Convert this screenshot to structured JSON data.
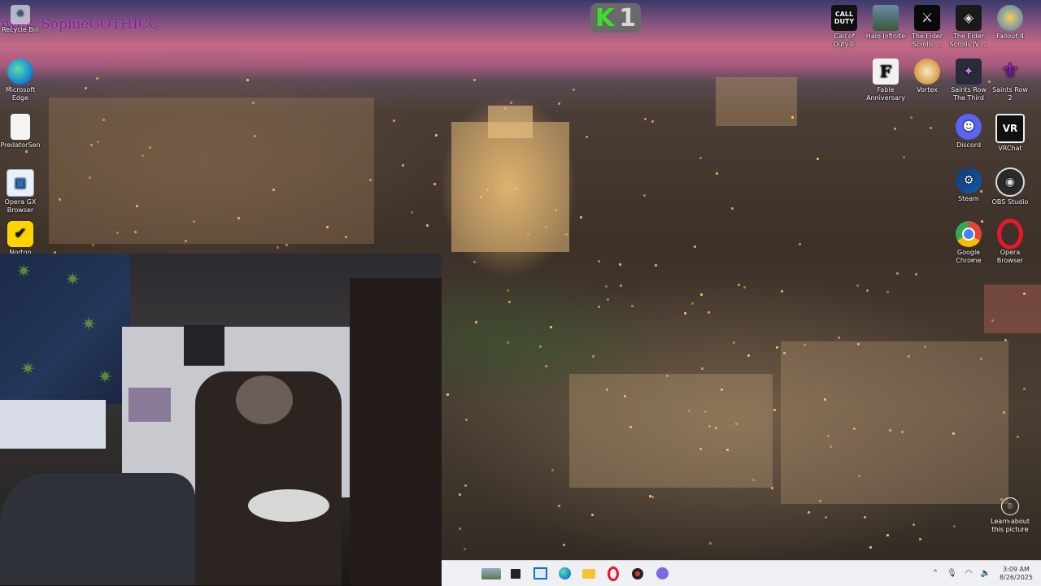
{
  "overlay": {
    "streamer_text": "ower: SophieGOTHICC",
    "badge": {
      "letter": "K",
      "number": "1"
    }
  },
  "desktop_icons_left": [
    {
      "name": "recycle-bin",
      "label": "Recycle Bin",
      "icon": "recycle-bin-icon"
    },
    {
      "name": "microsoft-edge",
      "label": "Microsoft Edge",
      "icon": "edge-icon"
    },
    {
      "name": "predatorsen",
      "label": "PredatorSen",
      "icon": "document-icon"
    },
    {
      "name": "opera-gx",
      "label": "Opera GX Browser",
      "icon": "opera-gx-icon"
    },
    {
      "name": "norton",
      "label": "Norton",
      "icon": "norton-icon"
    }
  ],
  "desktop_icons_right": [
    {
      "name": "call-of-duty",
      "label": "Call of Duty®",
      "icon": "call-of-duty-icon"
    },
    {
      "name": "halo-infinite",
      "label": "Halo Infinite",
      "icon": "halo-icon"
    },
    {
      "name": "elder-scrolls-1",
      "label": "The Elder Scrolls ...",
      "icon": "elder-scrolls-icon"
    },
    {
      "name": "elder-scrolls-iv",
      "label": "The Elder Scrolls IV ...",
      "icon": "oblivion-icon"
    },
    {
      "name": "fallout-4",
      "label": "Fallout 4",
      "icon": "fallout-icon"
    },
    {
      "name": "fable-anniversary",
      "label": "Fable Anniversary",
      "icon": "fable-icon"
    },
    {
      "name": "vortex",
      "label": "Vortex",
      "icon": "vortex-icon"
    },
    {
      "name": "saints-row-third",
      "label": "Saints Row The Third",
      "icon": "saints-row-icon"
    },
    {
      "name": "saints-row-2",
      "label": "Saints Row 2",
      "icon": "fleur-de-lis-icon"
    },
    {
      "name": "discord",
      "label": "Discord",
      "icon": "discord-icon"
    },
    {
      "name": "vrchat",
      "label": "VRChat",
      "icon": "vrchat-icon"
    },
    {
      "name": "steam",
      "label": "Steam",
      "icon": "steam-icon"
    },
    {
      "name": "obs-studio",
      "label": "OBS Studio",
      "icon": "obs-icon"
    },
    {
      "name": "google-chrome",
      "label": "Google Chrome",
      "icon": "chrome-icon"
    },
    {
      "name": "opera-browser",
      "label": "Opera Browser",
      "icon": "opera-icon"
    }
  ],
  "spotlight": {
    "label": "Learn about this picture",
    "icon": "camera-icon"
  },
  "taskbar": {
    "items": [
      {
        "name": "taskbar-widget",
        "icon": "landscape-widget-icon"
      },
      {
        "name": "taskbar-task-view",
        "icon": "task-view-icon"
      },
      {
        "name": "taskbar-store",
        "icon": "store-icon"
      },
      {
        "name": "taskbar-edge",
        "icon": "edge-icon"
      },
      {
        "name": "taskbar-file-explorer",
        "icon": "folder-icon"
      },
      {
        "name": "taskbar-opera",
        "icon": "opera-icon"
      },
      {
        "name": "taskbar-app",
        "icon": "app-icon"
      },
      {
        "name": "taskbar-chat",
        "icon": "chat-icon"
      }
    ],
    "time": "3:09 AM",
    "date": "8/26/2025"
  }
}
